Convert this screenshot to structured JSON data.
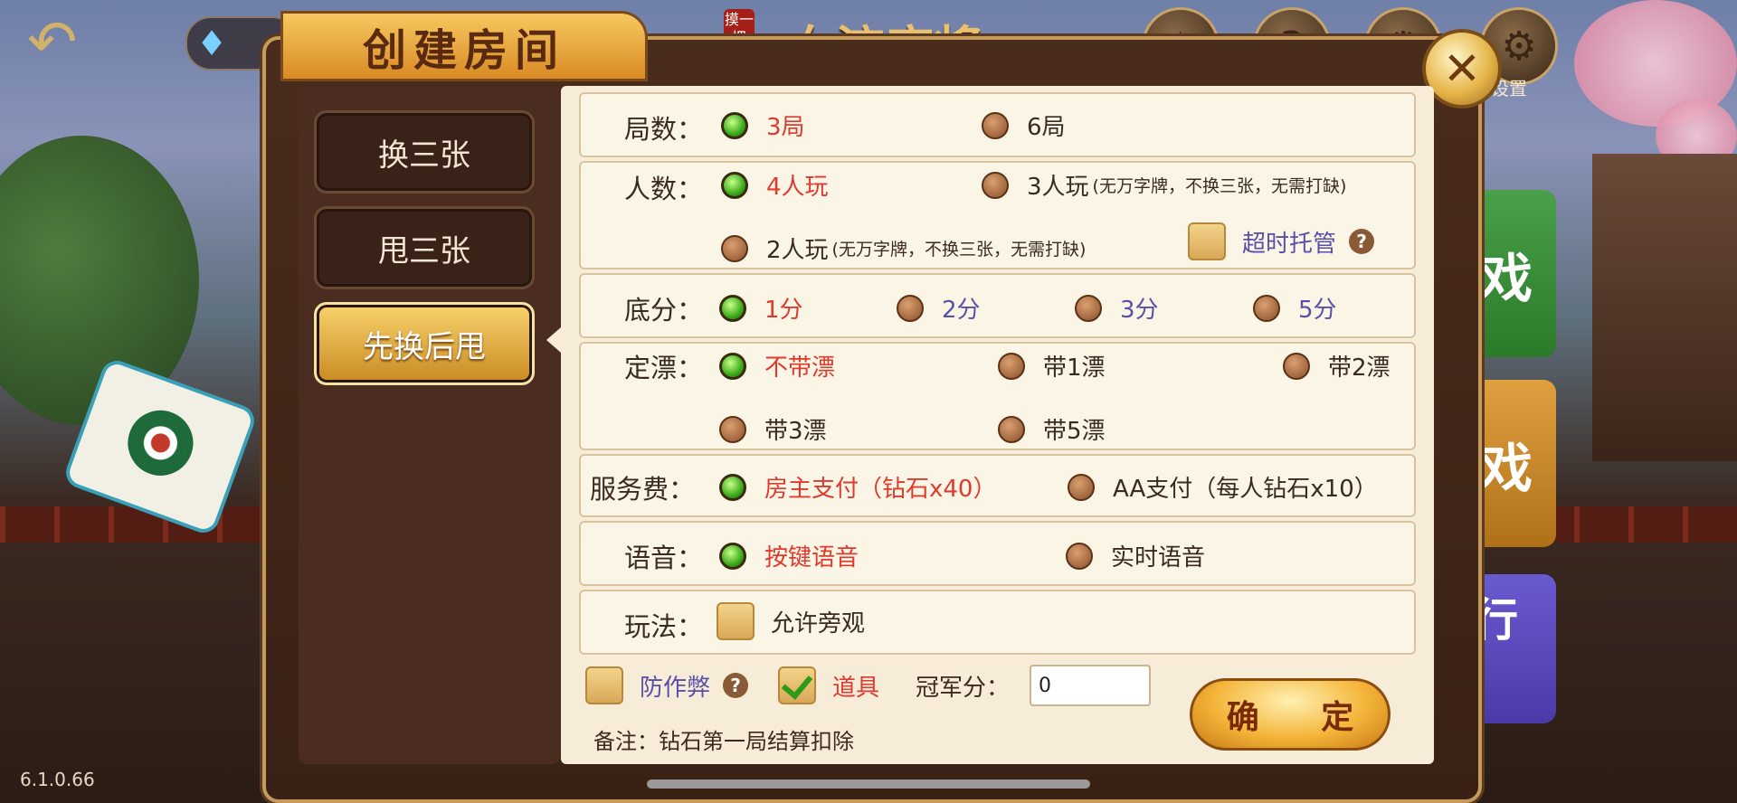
{
  "header": {
    "back_icon": "back-arrow-icon",
    "game_title": "血流麻将",
    "game_seal": "摸一把",
    "settings_label": "设置",
    "top_icons": [
      "medal-icon",
      "help-icon",
      "trophy-icon",
      "gear-icon"
    ]
  },
  "background": {
    "side_tiles": [
      "游戏",
      "游戏",
      "排行榜"
    ]
  },
  "dialog": {
    "title": "创建房间",
    "modes": [
      {
        "label": "换三张",
        "active": false
      },
      {
        "label": "甩三张",
        "active": false
      },
      {
        "label": "先换后甩",
        "active": true
      }
    ],
    "rounds": {
      "label": "局数：",
      "options": [
        "3局",
        "6局"
      ],
      "selected": 0
    },
    "players": {
      "label": "人数：",
      "opt1": "4人玩",
      "opt2": "3人玩",
      "opt2_note": "(无万字牌，不换三张，无需打缺)",
      "opt3": "2人玩",
      "opt3_note": "(无万字牌，不换三张，无需打缺)",
      "timeout": "超时托管",
      "selected": 0
    },
    "base_score": {
      "label": "底分：",
      "options": [
        "1分",
        "2分",
        "3分",
        "5分"
      ],
      "selected": 0
    },
    "piao": {
      "label": "定漂：",
      "options": [
        "不带漂",
        "带1漂",
        "带2漂",
        "带3漂",
        "带5漂"
      ],
      "selected": 0
    },
    "fee": {
      "label": "服务费：",
      "options": [
        "房主支付（钻石x40）",
        "AA支付（每人钻石x10）"
      ],
      "selected": 0
    },
    "voice": {
      "label": "语音：",
      "options": [
        "按键语音",
        "实时语音"
      ],
      "selected": 0
    },
    "play": {
      "label": "玩法：",
      "spectate": "允许旁观",
      "checked": false
    },
    "extras": {
      "anticheat": "防作弊",
      "anticheat_checked": false,
      "props": "道具",
      "props_checked": true,
      "champion_label": "冠军分：",
      "champion_value": "0"
    },
    "note": "备注：钻石第一局结算扣除",
    "confirm": "确  定"
  },
  "version": "6.1.0.66"
}
